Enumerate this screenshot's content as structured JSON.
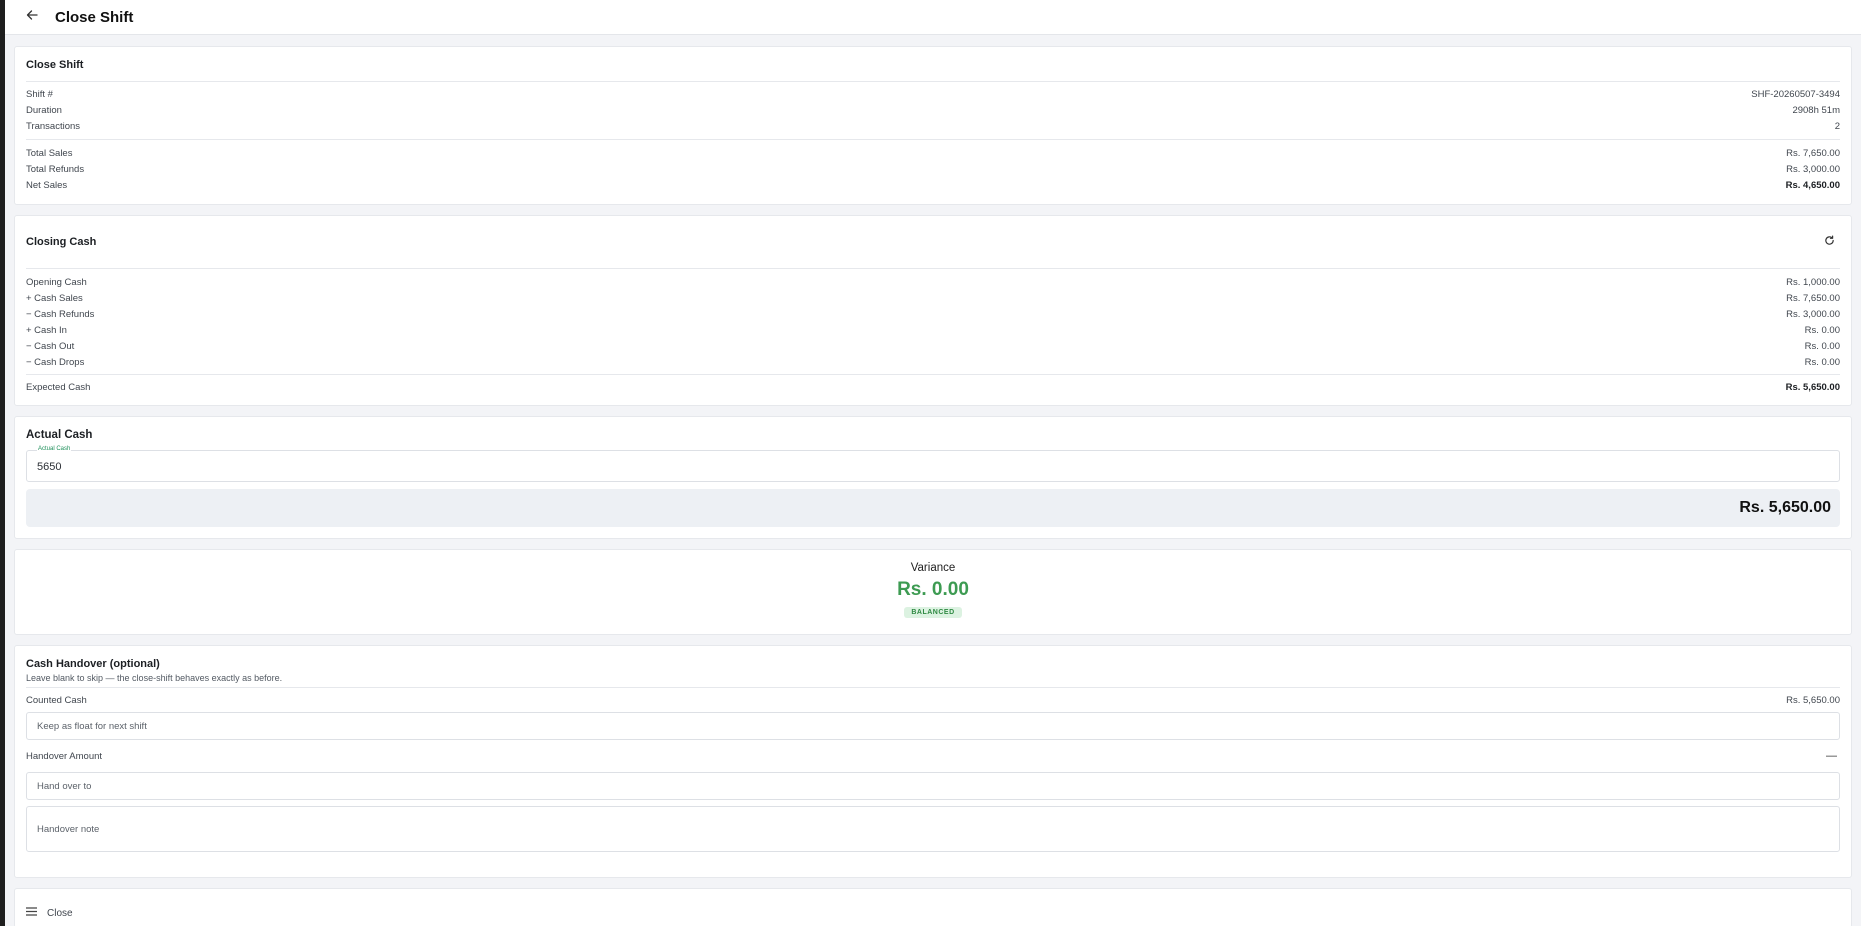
{
  "header": {
    "title": "Close Shift",
    "back_icon": "arrow-left-icon"
  },
  "summary": {
    "title": "Close Shift",
    "shift_info": [
      {
        "label": "Shift #",
        "value": "SHF-20260507-3494"
      },
      {
        "label": "Duration",
        "value": "2908h 51m"
      },
      {
        "label": "Transactions",
        "value": "2"
      }
    ],
    "sales": [
      {
        "label": "Total Sales",
        "value": "Rs. 7,650.00"
      },
      {
        "label": "Total Refunds",
        "value": "Rs. 3,000.00"
      },
      {
        "label": "Net Sales",
        "value": "Rs. 4,650.00"
      }
    ]
  },
  "closing_cash": {
    "title": "Closing Cash",
    "refresh_icon": "refresh-icon",
    "items": [
      {
        "label": "Opening Cash",
        "value": "Rs. 1,000.00"
      },
      {
        "label": "+ Cash Sales",
        "value": "Rs. 7,650.00"
      },
      {
        "label": "− Cash Refunds",
        "value": "Rs. 3,000.00"
      },
      {
        "label": "+ Cash In",
        "value": "Rs. 0.00"
      },
      {
        "label": "− Cash Out",
        "value": "Rs. 0.00"
      },
      {
        "label": "− Cash Drops",
        "value": "Rs. 0.00"
      }
    ],
    "expected": {
      "label": "Expected Cash",
      "value": "Rs. 5,650.00"
    }
  },
  "actual_cash": {
    "title": "Actual Cash",
    "field_label": "Actual Cash",
    "field_value": "5650",
    "formatted": "Rs. 5,650.00"
  },
  "variance": {
    "label": "Variance",
    "amount": "Rs. 0.00",
    "status": "BALANCED",
    "color": "#3d9b52"
  },
  "handover": {
    "title": "Cash Handover (optional)",
    "subtitle": "Leave blank to skip — the close-shift behaves exactly as before.",
    "counted_label": "Counted Cash",
    "counted_value": "Rs. 5,650.00",
    "float_placeholder": "Keep as float for next shift",
    "amount_label": "Handover Amount",
    "amount_value": "—",
    "hand_to_placeholder": "Hand over to",
    "note_placeholder": "Handover note"
  },
  "footer": {
    "close_label": "Close",
    "menu_icon": "menu-icon"
  }
}
